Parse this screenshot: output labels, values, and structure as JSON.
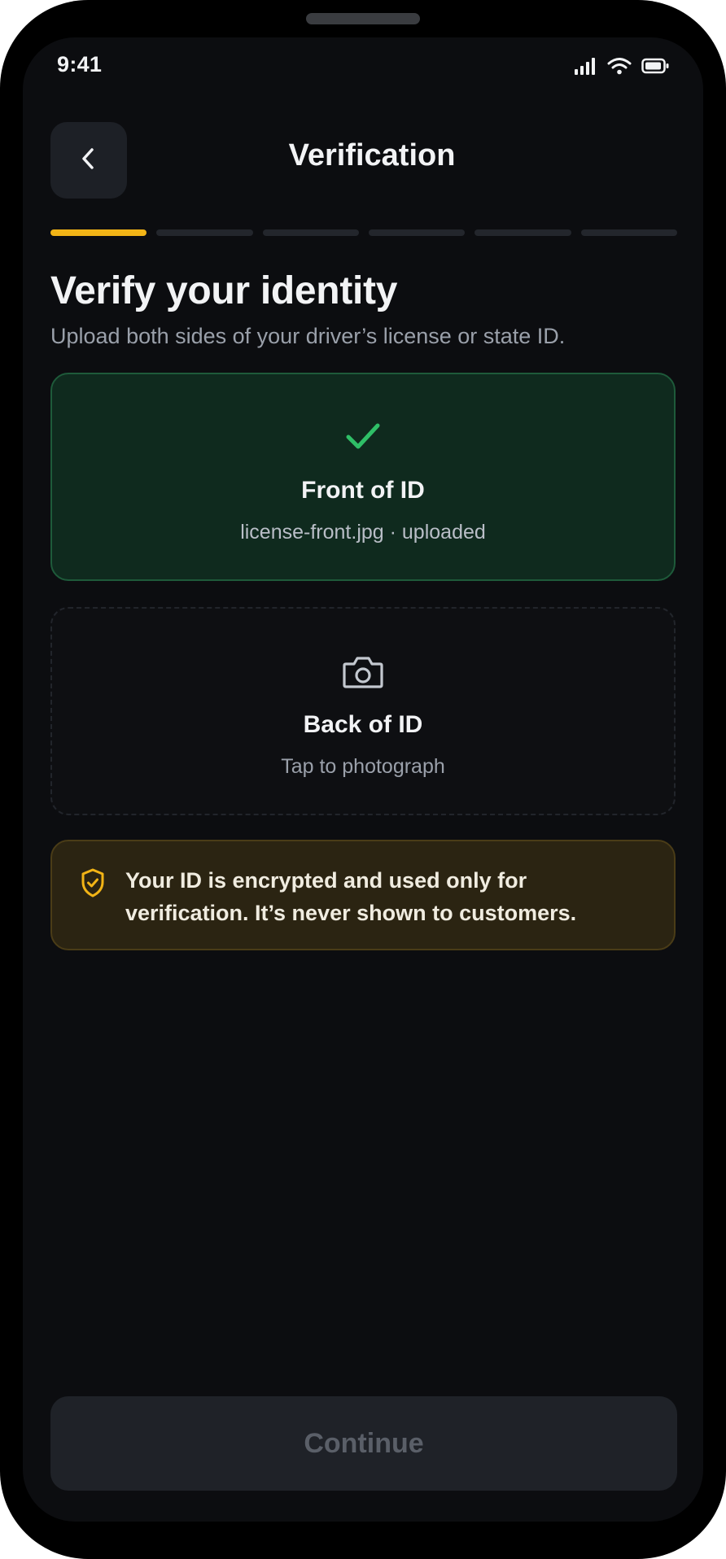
{
  "status_bar": {
    "time": "9:41",
    "icons": [
      "signal-icon",
      "wifi-icon",
      "battery-icon"
    ]
  },
  "header": {
    "back_icon": "chevron-left-icon",
    "title": "Verification"
  },
  "progress": {
    "total_steps": 6,
    "current_step": 1,
    "active_color": "#f2b416"
  },
  "content": {
    "heading": "Verify your identity",
    "subheading": "Upload both sides of your driver’s license or state ID."
  },
  "front_card": {
    "icon": "checkmark-icon",
    "title": "Front of ID",
    "status": "license-front.jpg · uploaded",
    "state": "uploaded",
    "accent_color": "#2fbf67"
  },
  "back_card": {
    "icon": "camera-icon",
    "title": "Back of ID",
    "status": "Tap to photograph",
    "state": "pending"
  },
  "notice": {
    "icon": "shield-check-icon",
    "text": "Your ID is encrypted and used only for verification. It’s never shown to customers.",
    "accent_color": "#f2b416"
  },
  "footer": {
    "continue_label": "Continue",
    "continue_enabled": false
  }
}
